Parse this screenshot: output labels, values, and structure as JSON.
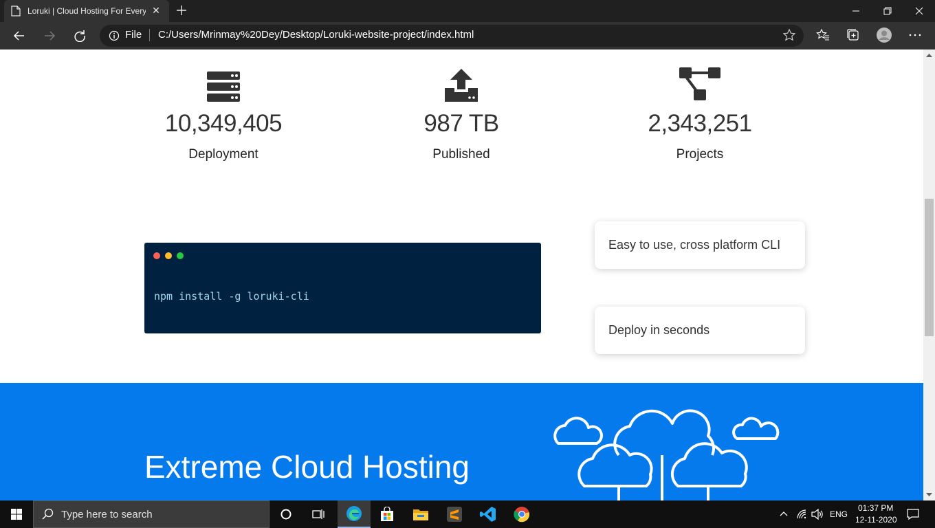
{
  "browser": {
    "tab_title": "Loruki | Cloud Hosting For Everyone",
    "address_scheme": "File",
    "address_url": "C:/Users/Mrinmay%20Dey/Desktop/Loruki-website-project/index.html",
    "icons": [
      "page-icon",
      "tab-close-icon",
      "new-tab-icon",
      "minimize-icon",
      "restore-icon",
      "close-icon",
      "back-icon",
      "forward-icon",
      "refresh-icon",
      "info-icon",
      "favorite-star-icon",
      "favorites-icon",
      "collections-icon",
      "profile-icon",
      "more-icon"
    ]
  },
  "stats": [
    {
      "icon": "server-icon",
      "value": "10,349,405",
      "label": "Deployment"
    },
    {
      "icon": "upload-icon",
      "value": "987 TB",
      "label": "Published"
    },
    {
      "icon": "project-diagram-icon",
      "value": "2,343,251",
      "label": "Projects"
    }
  ],
  "terminal": {
    "command": "npm install -g loruki-cli",
    "dot_colors": [
      "#ff5f56",
      "#ffbd2e",
      "#27c93f"
    ]
  },
  "features": [
    {
      "text": "Easy to use, cross platform CLI"
    },
    {
      "text": "Deploy in seconds"
    }
  ],
  "hero": {
    "title": "Extreme Cloud Hosting",
    "background": "#047aed"
  },
  "taskbar": {
    "search_placeholder": "Type here to search",
    "language": "ENG",
    "time": "01:37 PM",
    "date": "12-11-2020",
    "apps": [
      "cortana-icon",
      "task-view-icon",
      "edge-icon",
      "store-icon",
      "file-explorer-icon",
      "sublime-text-icon",
      "vscode-icon",
      "chrome-icon"
    ]
  }
}
